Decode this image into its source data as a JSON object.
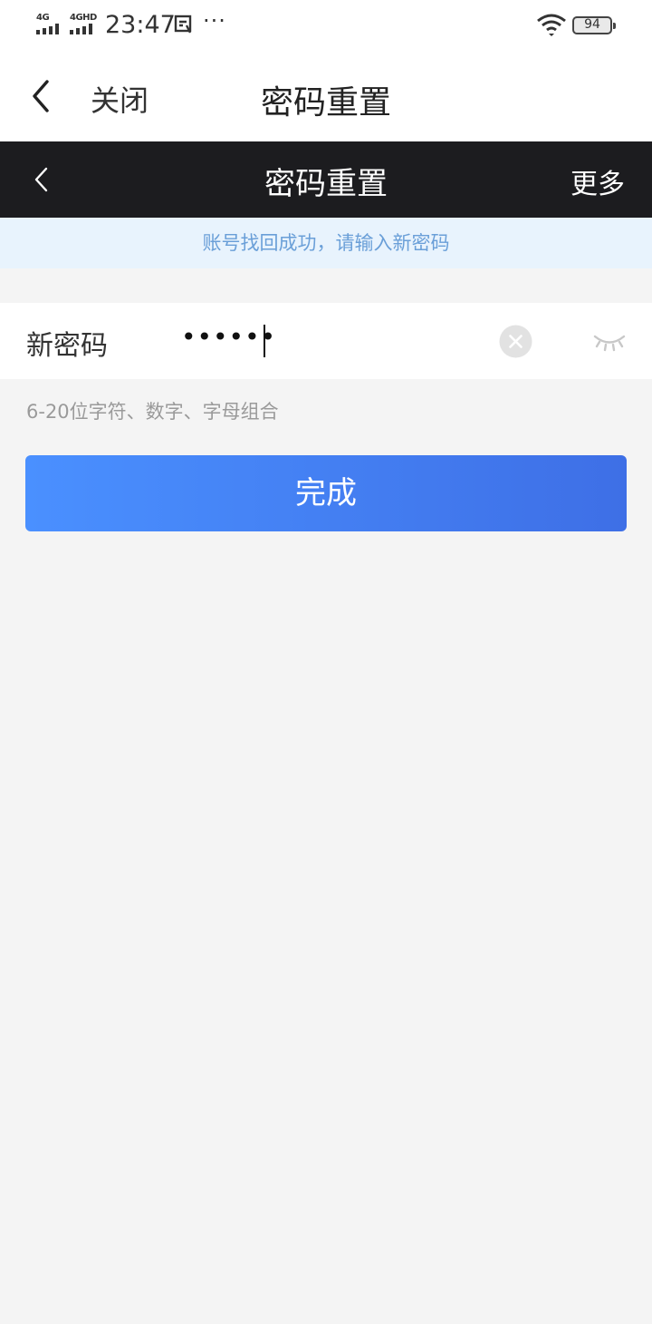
{
  "status_bar": {
    "signal_1_label": "4G",
    "signal_2_label": "4GHD",
    "time": "23:47",
    "more": "···",
    "battery": "94",
    "icons": [
      "signal-icon",
      "signal-icon",
      "screenshot-icon",
      "wifi-icon",
      "battery-icon"
    ]
  },
  "top_nav": {
    "back_icon": "chevron-left-icon",
    "close_label": "关闭",
    "title": "密码重置"
  },
  "page_header": {
    "back_icon": "chevron-left-icon",
    "title": "密码重置",
    "more_label": "更多"
  },
  "notice": {
    "text": "账号找回成功，请输入新密码",
    "color": "#6a9fd8",
    "background": "#e8f3fd"
  },
  "password_field": {
    "label": "新密码",
    "value": "••••••",
    "clear_icon": "clear-icon",
    "visibility_icon": "eye-closed-icon"
  },
  "hint": {
    "text": "6-20位字符、数字、字母组合"
  },
  "done_button": {
    "label": "完成",
    "color_start": "#4a90ff",
    "color_end": "#3e6fe6"
  }
}
